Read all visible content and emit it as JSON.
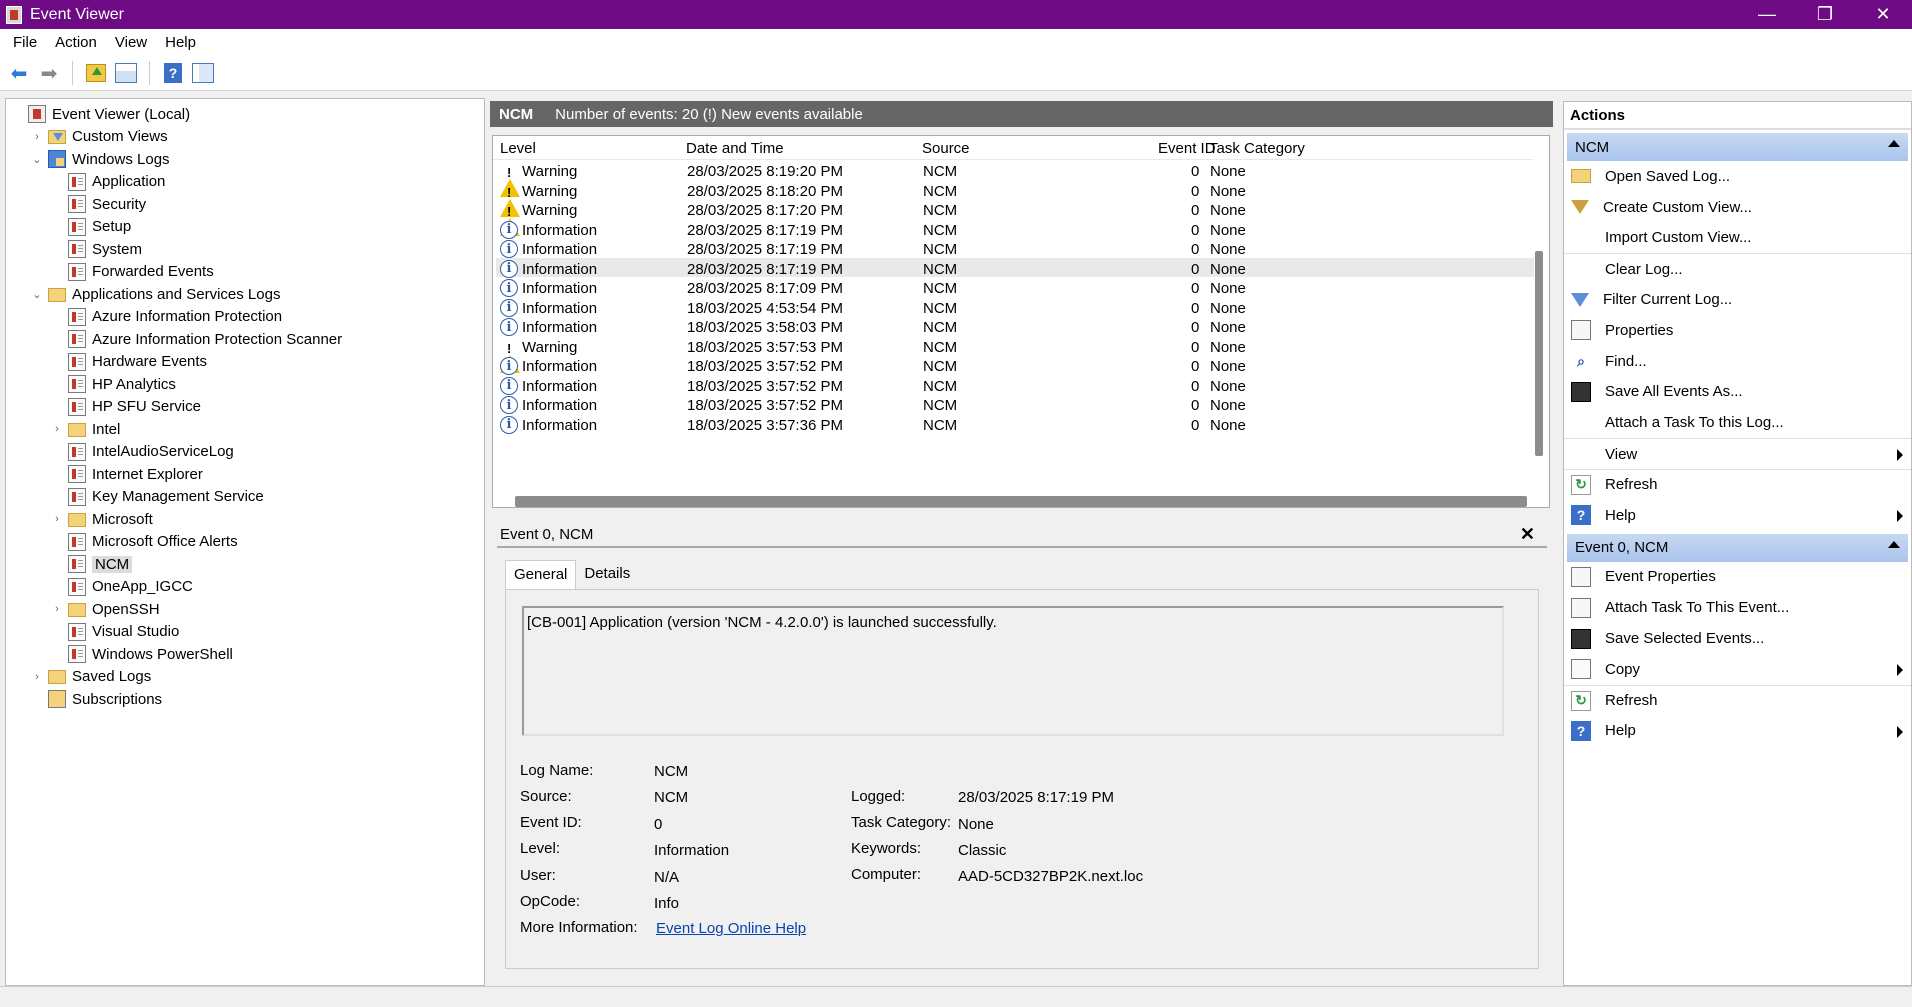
{
  "window": {
    "title": "Event Viewer",
    "controls": {
      "minimize": "—",
      "restore": "❐",
      "close": "✕"
    }
  },
  "menu": [
    "File",
    "Action",
    "View",
    "Help"
  ],
  "tree": [
    {
      "label": "Event Viewer (Local)",
      "depth": 0,
      "exp": "",
      "icon": "root"
    },
    {
      "label": "Custom Views",
      "depth": 1,
      "exp": "›",
      "icon": "custom"
    },
    {
      "label": "Windows Logs",
      "depth": 1,
      "exp": "⌄",
      "icon": "winlogs"
    },
    {
      "label": "Application",
      "depth": 2,
      "exp": "",
      "icon": "log"
    },
    {
      "label": "Security",
      "depth": 2,
      "exp": "",
      "icon": "log"
    },
    {
      "label": "Setup",
      "depth": 2,
      "exp": "",
      "icon": "log"
    },
    {
      "label": "System",
      "depth": 2,
      "exp": "",
      "icon": "log"
    },
    {
      "label": "Forwarded Events",
      "depth": 2,
      "exp": "",
      "icon": "log"
    },
    {
      "label": "Applications and Services Logs",
      "depth": 1,
      "exp": "⌄",
      "icon": "folder"
    },
    {
      "label": "Azure Information Protection",
      "depth": 2,
      "exp": "",
      "icon": "log"
    },
    {
      "label": "Azure Information Protection Scanner",
      "depth": 2,
      "exp": "",
      "icon": "log"
    },
    {
      "label": "Hardware Events",
      "depth": 2,
      "exp": "",
      "icon": "log"
    },
    {
      "label": "HP Analytics",
      "depth": 2,
      "exp": "",
      "icon": "log"
    },
    {
      "label": "HP SFU Service",
      "depth": 2,
      "exp": "",
      "icon": "log"
    },
    {
      "label": "Intel",
      "depth": 2,
      "exp": "›",
      "icon": "folder"
    },
    {
      "label": "IntelAudioServiceLog",
      "depth": 2,
      "exp": "",
      "icon": "log"
    },
    {
      "label": "Internet Explorer",
      "depth": 2,
      "exp": "",
      "icon": "log"
    },
    {
      "label": "Key Management Service",
      "depth": 2,
      "exp": "",
      "icon": "log"
    },
    {
      "label": "Microsoft",
      "depth": 2,
      "exp": "›",
      "icon": "folder"
    },
    {
      "label": "Microsoft Office Alerts",
      "depth": 2,
      "exp": "",
      "icon": "log"
    },
    {
      "label": "NCM",
      "depth": 2,
      "exp": "",
      "icon": "log",
      "selected": true
    },
    {
      "label": "OneApp_IGCC",
      "depth": 2,
      "exp": "",
      "icon": "log"
    },
    {
      "label": "OpenSSH",
      "depth": 2,
      "exp": "›",
      "icon": "folder"
    },
    {
      "label": "Visual Studio",
      "depth": 2,
      "exp": "",
      "icon": "log"
    },
    {
      "label": "Windows PowerShell",
      "depth": 2,
      "exp": "",
      "icon": "log"
    },
    {
      "label": "Saved Logs",
      "depth": 1,
      "exp": "›",
      "icon": "saved"
    },
    {
      "label": "Subscriptions",
      "depth": 1,
      "exp": "",
      "icon": "subs"
    }
  ],
  "center": {
    "log_name": "NCM",
    "summary": "Number of events: 20 (!) New events available"
  },
  "events": {
    "columns": [
      "Level",
      "Date and Time",
      "Source",
      "Event ID",
      "Task Category"
    ],
    "rows": [
      {
        "level": "Warning",
        "type": "warn",
        "date": "28/03/2025 8:19:20 PM",
        "source": "NCM",
        "id": "0",
        "cat": "None"
      },
      {
        "level": "Warning",
        "type": "warn",
        "date": "28/03/2025 8:18:20 PM",
        "source": "NCM",
        "id": "0",
        "cat": "None"
      },
      {
        "level": "Warning",
        "type": "warn",
        "date": "28/03/2025 8:17:20 PM",
        "source": "NCM",
        "id": "0",
        "cat": "None"
      },
      {
        "level": "Information",
        "type": "info",
        "date": "28/03/2025 8:17:19 PM",
        "source": "NCM",
        "id": "0",
        "cat": "None"
      },
      {
        "level": "Information",
        "type": "info",
        "date": "28/03/2025 8:17:19 PM",
        "source": "NCM",
        "id": "0",
        "cat": "None"
      },
      {
        "level": "Information",
        "type": "info",
        "date": "28/03/2025 8:17:19 PM",
        "source": "NCM",
        "id": "0",
        "cat": "None",
        "selected": true
      },
      {
        "level": "Information",
        "type": "info",
        "date": "28/03/2025 8:17:09 PM",
        "source": "NCM",
        "id": "0",
        "cat": "None"
      },
      {
        "level": "Information",
        "type": "info",
        "date": "18/03/2025 4:53:54 PM",
        "source": "NCM",
        "id": "0",
        "cat": "None"
      },
      {
        "level": "Information",
        "type": "info",
        "date": "18/03/2025 3:58:03 PM",
        "source": "NCM",
        "id": "0",
        "cat": "None"
      },
      {
        "level": "Warning",
        "type": "warn",
        "date": "18/03/2025 3:57:53 PM",
        "source": "NCM",
        "id": "0",
        "cat": "None"
      },
      {
        "level": "Information",
        "type": "info",
        "date": "18/03/2025 3:57:52 PM",
        "source": "NCM",
        "id": "0",
        "cat": "None"
      },
      {
        "level": "Information",
        "type": "info",
        "date": "18/03/2025 3:57:52 PM",
        "source": "NCM",
        "id": "0",
        "cat": "None"
      },
      {
        "level": "Information",
        "type": "info",
        "date": "18/03/2025 3:57:52 PM",
        "source": "NCM",
        "id": "0",
        "cat": "None"
      },
      {
        "level": "Information",
        "type": "info",
        "date": "18/03/2025 3:57:36 PM",
        "source": "NCM",
        "id": "0",
        "cat": "None"
      }
    ]
  },
  "detail": {
    "title": "Event 0, NCM",
    "tabs": [
      "General",
      "Details"
    ],
    "message": "[CB-001] Application (version 'NCM - 4.2.0.0') is launched successfully.",
    "fields": {
      "log_name_label": "Log Name:",
      "log_name": "NCM",
      "source_label": "Source:",
      "source": "NCM",
      "logged_label": "Logged:",
      "logged": "28/03/2025 8:17:19 PM",
      "event_id_label": "Event ID:",
      "event_id": "0",
      "task_cat_label": "Task Category:",
      "task_cat": "None",
      "level_label": "Level:",
      "level": "Information",
      "keywords_label": "Keywords:",
      "keywords": "Classic",
      "user_label": "User:",
      "user": "N/A",
      "computer_label": "Computer:",
      "computer": "AAD-5CD327BP2K.next.loc",
      "opcode_label": "OpCode:",
      "opcode": "Info",
      "more_info_label": "More Information:",
      "more_info_link": "Event Log Online Help"
    }
  },
  "actions": {
    "title": "Actions",
    "section1": "NCM",
    "items1": [
      {
        "label": "Open Saved Log...",
        "icon": "folder",
        "sub": false
      },
      {
        "label": "Create Custom View...",
        "icon": "funnel",
        "sub": false
      },
      {
        "label": "Import Custom View...",
        "icon": "",
        "sub": false
      },
      {
        "label": "Clear Log...",
        "icon": "",
        "sub": false,
        "sep": true
      },
      {
        "label": "Filter Current Log...",
        "icon": "funnel-b",
        "sub": false
      },
      {
        "label": "Properties",
        "icon": "props",
        "sub": false
      },
      {
        "label": "Find...",
        "icon": "find",
        "sub": false
      },
      {
        "label": "Save All Events As...",
        "icon": "save",
        "sub": false
      },
      {
        "label": "Attach a Task To this Log...",
        "icon": "",
        "sub": false
      },
      {
        "label": "View",
        "icon": "",
        "sub": true,
        "sep": true
      },
      {
        "label": "Refresh",
        "icon": "refresh",
        "sub": false,
        "sep": true
      },
      {
        "label": "Help",
        "icon": "help",
        "sub": true
      }
    ],
    "section2": "Event 0, NCM",
    "items2": [
      {
        "label": "Event Properties",
        "icon": "props",
        "sub": false
      },
      {
        "label": "Attach Task To This Event...",
        "icon": "props",
        "sub": false
      },
      {
        "label": "Save Selected Events...",
        "icon": "save",
        "sub": false
      },
      {
        "label": "Copy",
        "icon": "copy",
        "sub": true
      },
      {
        "label": "Refresh",
        "icon": "refresh",
        "sub": false,
        "sep": true
      },
      {
        "label": "Help",
        "icon": "help",
        "sub": true
      }
    ]
  }
}
